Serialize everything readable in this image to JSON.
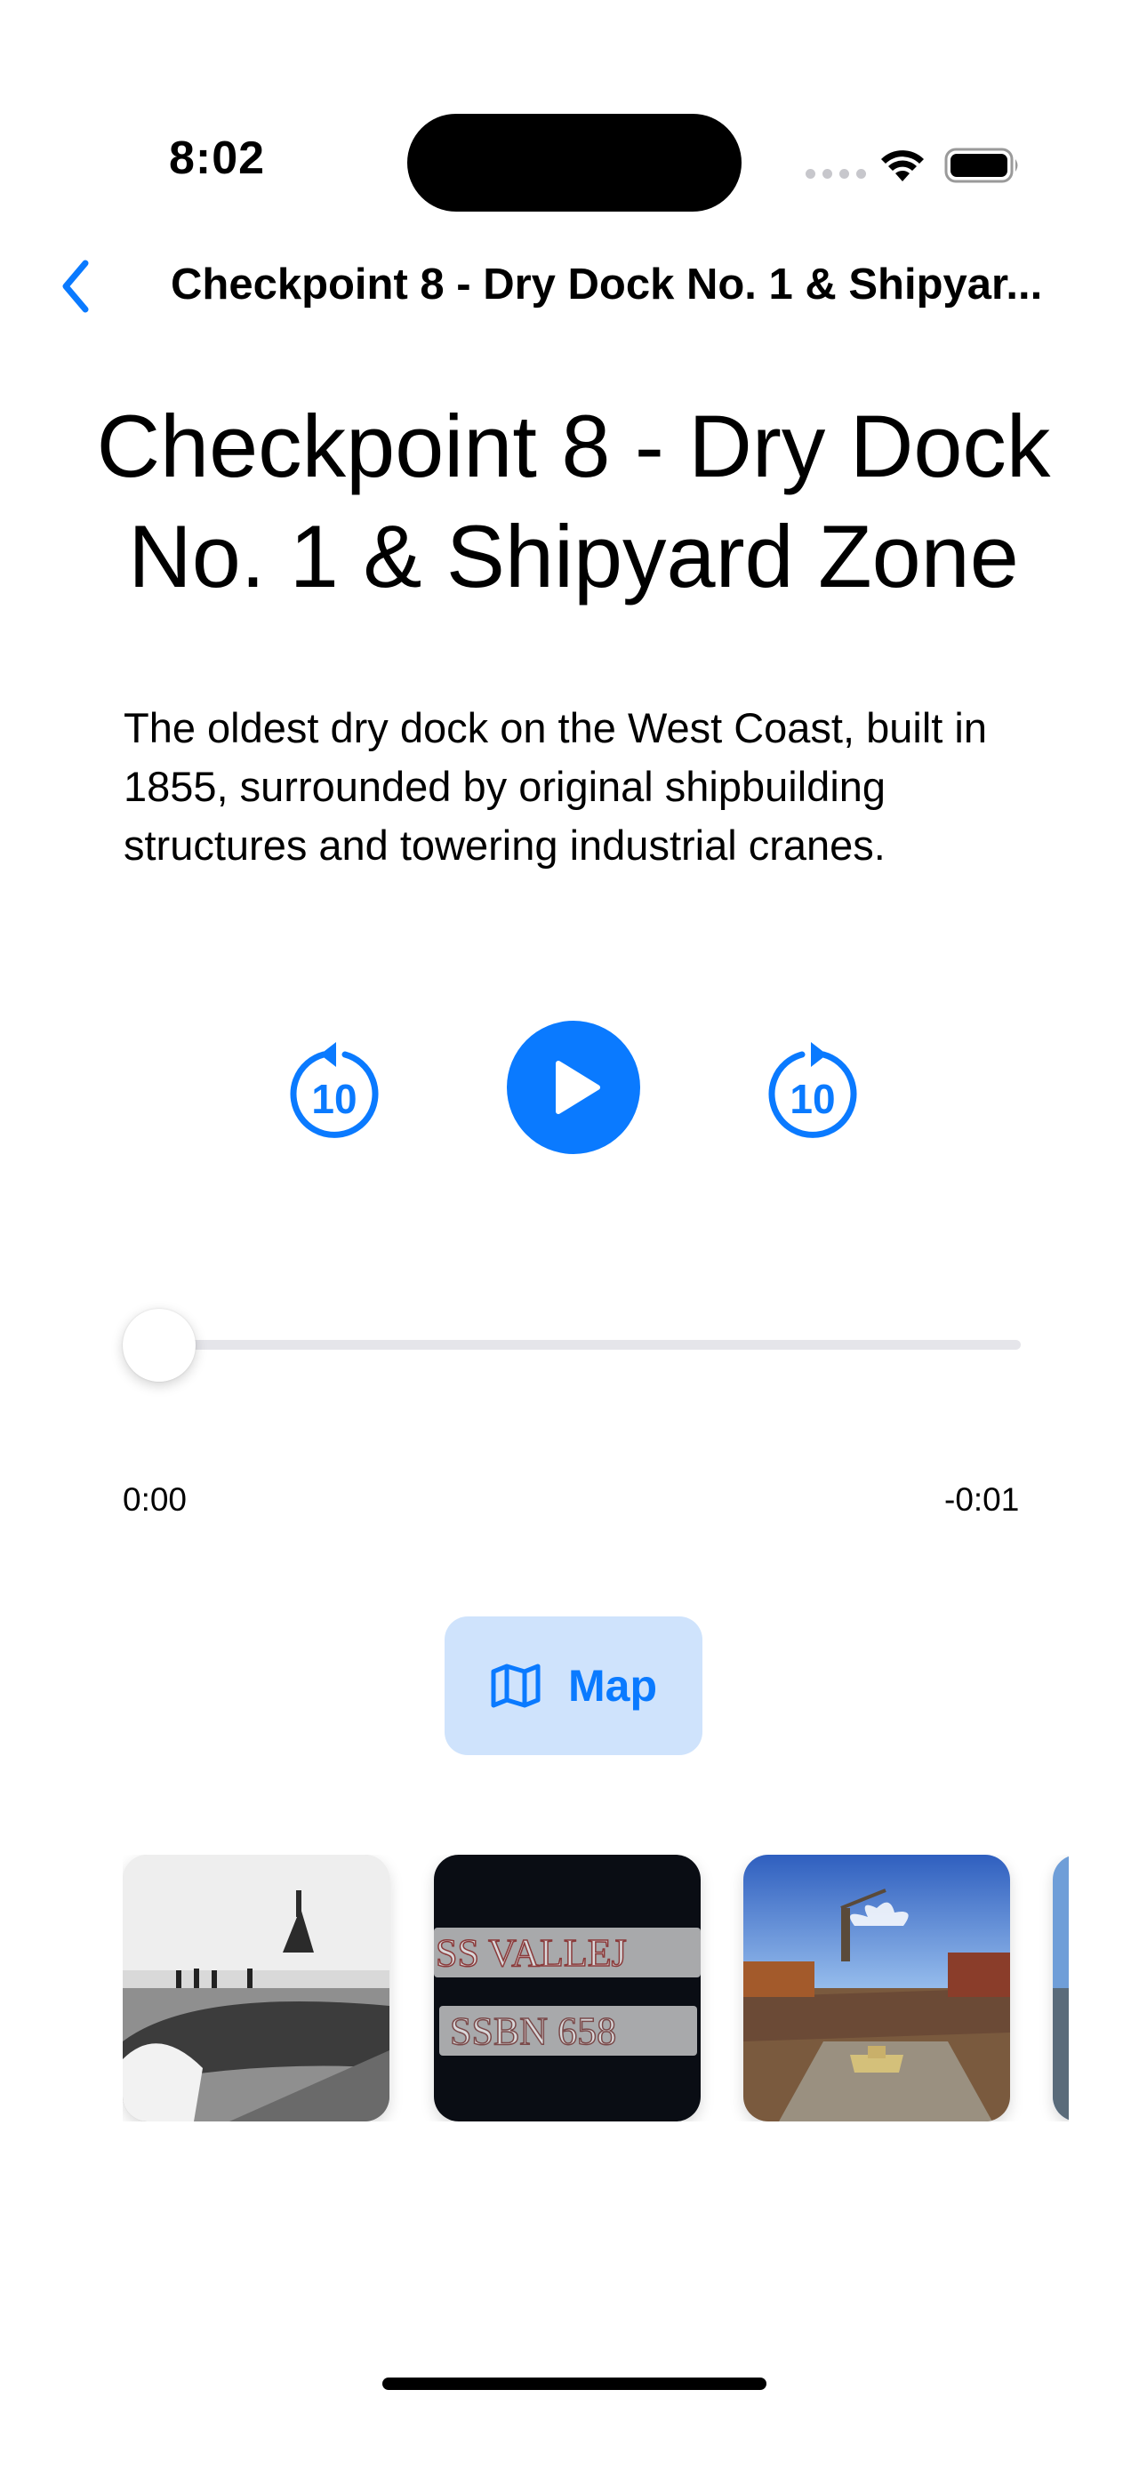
{
  "status_bar": {
    "time": "8:02"
  },
  "nav": {
    "title": "Checkpoint 8 - Dry Dock No. 1 & Shipyar...",
    "back_icon": "chevron-left-icon"
  },
  "checkpoint": {
    "title": "Checkpoint 8 - Dry Dock No. 1 & Shipyard Zone",
    "description": "The oldest dry dock on the West Coast, built in 1855, surrounded by original shipbuilding structures and towering industrial cranes."
  },
  "player": {
    "rewind_seconds": "10",
    "forward_seconds": "10",
    "elapsed": "0:00",
    "remaining": "-0:01",
    "progress": 0
  },
  "map_button": {
    "label": "Map",
    "icon": "map-icon"
  },
  "gallery": {
    "photo_2_line1": "SS VALLEJ",
    "photo_2_line2": "SSBN 658"
  },
  "colors": {
    "accent": "#0a7aff",
    "map_button_bg": "#cfe3fc",
    "track": "#e5e5ea"
  }
}
